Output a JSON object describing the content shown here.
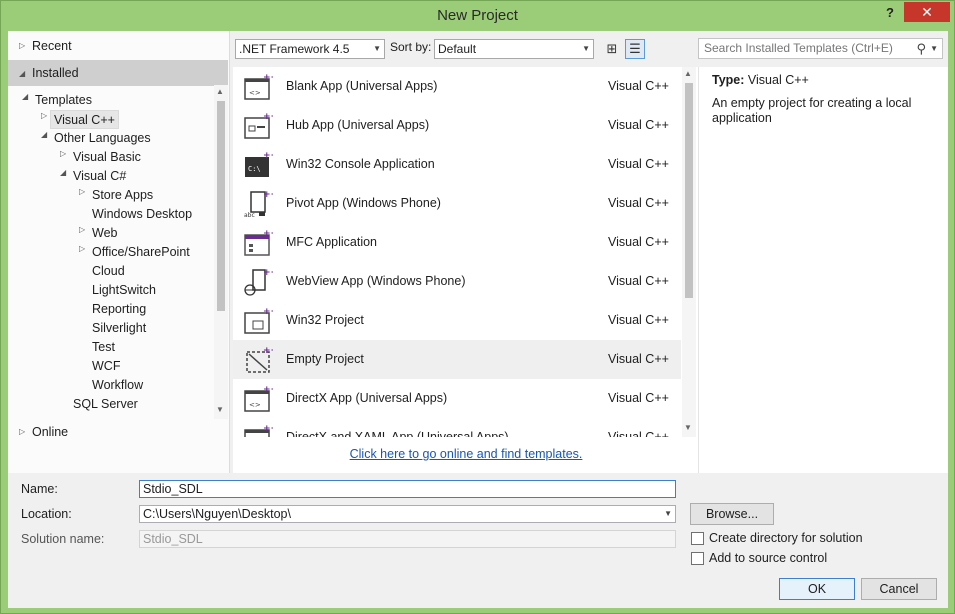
{
  "window": {
    "title": "New Project",
    "help": "?",
    "close": "✕"
  },
  "left_nav": {
    "recent": "Recent",
    "installed": "Installed",
    "online": "Online",
    "tree": [
      {
        "label": "Templates",
        "expander": "open"
      },
      {
        "label": "Visual C++",
        "expander": "closed",
        "selected": true
      },
      {
        "label": "Other Languages",
        "expander": "open"
      },
      {
        "label": "Visual Basic",
        "expander": "closed"
      },
      {
        "label": "Visual C#",
        "expander": "open"
      },
      {
        "label": "Store Apps",
        "expander": "closed"
      },
      {
        "label": "Windows Desktop",
        "expander": "none"
      },
      {
        "label": "Web",
        "expander": "closed"
      },
      {
        "label": "Office/SharePoint",
        "expander": "closed"
      },
      {
        "label": "Cloud",
        "expander": "none"
      },
      {
        "label": "LightSwitch",
        "expander": "none"
      },
      {
        "label": "Reporting",
        "expander": "none"
      },
      {
        "label": "Silverlight",
        "expander": "none"
      },
      {
        "label": "Test",
        "expander": "none"
      },
      {
        "label": "WCF",
        "expander": "none"
      },
      {
        "label": "Workflow",
        "expander": "none"
      },
      {
        "label": "SQL Server",
        "expander": "none"
      }
    ]
  },
  "toolbar": {
    "framework": ".NET Framework 4.5",
    "sort_label": "Sort by:",
    "sort_value": "Default",
    "view_grid_icon": "grid-view-icon",
    "view_list_icon": "list-view-icon"
  },
  "templates": [
    {
      "name": "Blank App (Universal Apps)",
      "lang": "Visual C++",
      "icon": "blank-app-icon"
    },
    {
      "name": "Hub App (Universal Apps)",
      "lang": "Visual C++",
      "icon": "hub-app-icon"
    },
    {
      "name": "Win32 Console Application",
      "lang": "Visual C++",
      "icon": "console-app-icon"
    },
    {
      "name": "Pivot App (Windows Phone)",
      "lang": "Visual C++",
      "icon": "pivot-app-icon"
    },
    {
      "name": "MFC Application",
      "lang": "Visual C++",
      "icon": "mfc-app-icon"
    },
    {
      "name": "WebView App (Windows Phone)",
      "lang": "Visual C++",
      "icon": "webview-app-icon"
    },
    {
      "name": "Win32 Project",
      "lang": "Visual C++",
      "icon": "win32-project-icon"
    },
    {
      "name": "Empty Project",
      "lang": "Visual C++",
      "icon": "empty-project-icon",
      "selected": true
    },
    {
      "name": "DirectX App (Universal Apps)",
      "lang": "Visual C++",
      "icon": "directx-app-icon"
    },
    {
      "name": "DirectX and XAML App (Universal Apps)",
      "lang": "Visual C++",
      "icon": "directx-xaml-app-icon"
    }
  ],
  "online_link": "Click here to go online and find templates.",
  "search": {
    "placeholder": "Search Installed Templates (Ctrl+E)"
  },
  "details": {
    "type_label": "Type:",
    "type_value": "Visual C++",
    "description": "An empty project for creating a local application"
  },
  "form": {
    "name_label": "Name:",
    "name_value": "Stdio_SDL",
    "location_label": "Location:",
    "location_value": "C:\\Users\\Nguyen\\Desktop\\",
    "solution_label": "Solution name:",
    "solution_value": "Stdio_SDL",
    "browse": "Browse...",
    "create_dir": "Create directory for solution",
    "add_source": "Add to source control",
    "ok": "OK",
    "cancel": "Cancel"
  }
}
